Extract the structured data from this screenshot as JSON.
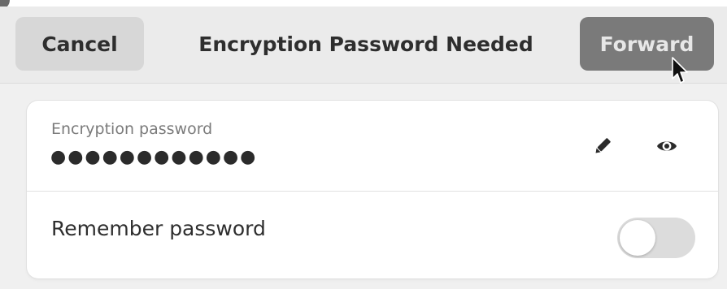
{
  "header": {
    "cancel_label": "Cancel",
    "title": "Encryption Password Needed",
    "forward_label": "Forward"
  },
  "password_field": {
    "label": "Encryption password",
    "value": "●●●●●●●●●●●●",
    "edit_icon": "pencil-icon",
    "reveal_icon": "eye-icon"
  },
  "remember": {
    "label": "Remember password",
    "enabled": false
  },
  "colors": {
    "forward_bg": "#7a7a7a",
    "cancel_bg": "#d7d7d7",
    "switch_off": "#dcdcdc"
  }
}
